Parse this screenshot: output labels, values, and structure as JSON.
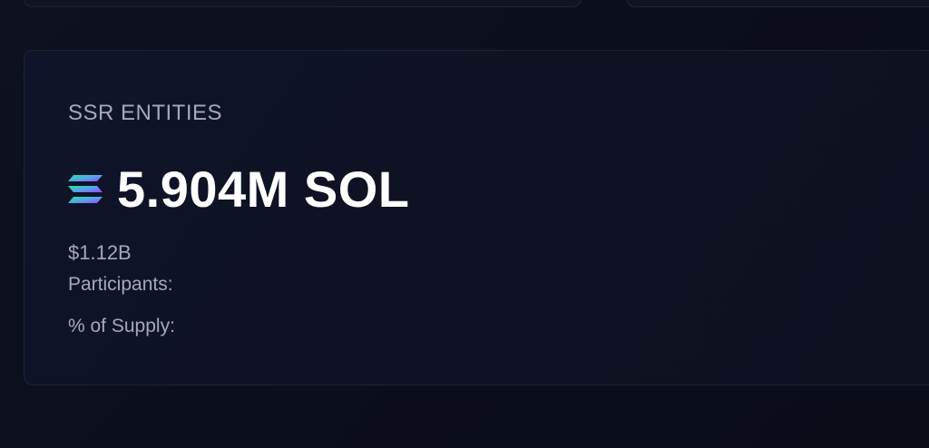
{
  "card": {
    "title": "SSR ENTITIES",
    "amount": "5.904M SOL",
    "usd_value": "$1.12B",
    "participants_label": "Participants:",
    "participants_value": "",
    "supply_label": "% of Supply:",
    "supply_value": "",
    "icon": "solana-logo-icon"
  },
  "colors": {
    "background": "#0b0e1a",
    "card_border": "#1e2334",
    "muted_text": "#a3a9bb",
    "primary_text": "#ffffff",
    "solana_gradient_start": "#14f195",
    "solana_gradient_end": "#9945ff"
  }
}
